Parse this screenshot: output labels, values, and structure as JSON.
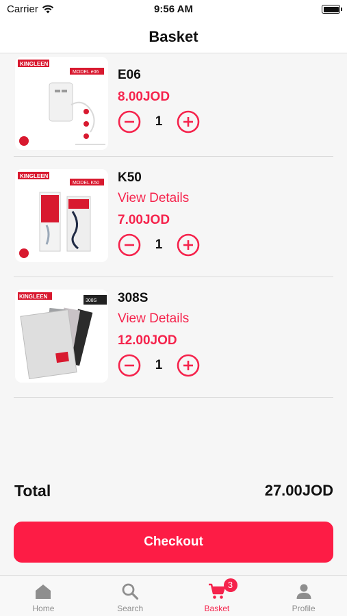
{
  "status_bar": {
    "carrier": "Carrier",
    "time": "9:56 AM"
  },
  "header": {
    "title": "Basket"
  },
  "basket_items": [
    {
      "name": "E06",
      "details_link": "",
      "price": "8.00JOD",
      "quantity": "1",
      "brand": "KINGLEEN",
      "model": "MODEL e06"
    },
    {
      "name": "K50",
      "details_link": "View Details",
      "price": "7.00JOD",
      "quantity": "1",
      "brand": "KINGLEEN",
      "model": "MODEL K50"
    },
    {
      "name": "308S",
      "details_link": "View Details",
      "price": "12.00JOD",
      "quantity": "1",
      "brand": "KINGLEEN",
      "model": "308S"
    }
  ],
  "total": {
    "label": "Total",
    "value": "27.00JOD"
  },
  "checkout": {
    "label": "Checkout"
  },
  "tab_bar": {
    "tabs": [
      {
        "label": "Home",
        "icon": "home-icon"
      },
      {
        "label": "Search",
        "icon": "search-icon"
      },
      {
        "label": "Basket",
        "icon": "cart-icon",
        "badge": "3",
        "active": true
      },
      {
        "label": "Profile",
        "icon": "profile-icon"
      }
    ]
  },
  "colors": {
    "accent": "#f5234c",
    "button": "#fd1c45",
    "background": "#f6f6f6",
    "inactive_tab": "#8e8e8e"
  }
}
